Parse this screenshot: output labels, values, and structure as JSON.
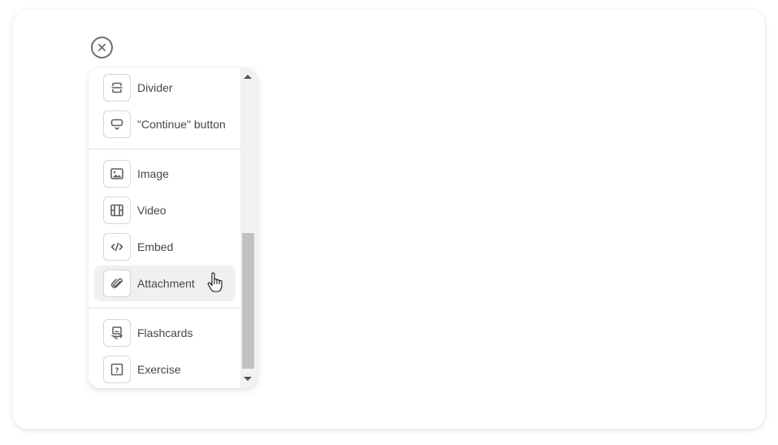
{
  "close_button": {
    "icon": "close-circle-icon",
    "label": "Close"
  },
  "menu": {
    "groups": [
      {
        "items": [
          {
            "label": "Divider",
            "icon": "divider-icon"
          },
          {
            "label": "\"Continue\" button",
            "icon": "continue-button-icon"
          }
        ]
      },
      {
        "items": [
          {
            "label": "Image",
            "icon": "image-icon"
          },
          {
            "label": "Video",
            "icon": "video-icon"
          },
          {
            "label": "Embed",
            "icon": "code-icon"
          },
          {
            "label": "Attachment",
            "icon": "paperclip-icon",
            "hovered": true
          }
        ]
      },
      {
        "items": [
          {
            "label": "Flashcards",
            "icon": "flashcards-icon"
          },
          {
            "label": "Exercise",
            "icon": "question-icon"
          }
        ]
      }
    ],
    "scroll_position_fraction": 0.55
  },
  "cursor": {
    "type": "pointer-hand",
    "over": "Attachment"
  }
}
